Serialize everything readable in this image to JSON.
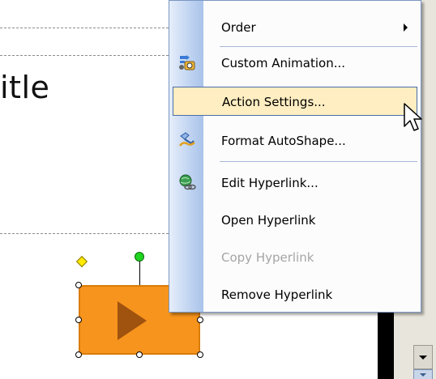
{
  "slide": {
    "title_fragment": "itle"
  },
  "menu": {
    "items": [
      {
        "label": "Order",
        "icon": "",
        "has_submenu": true,
        "enabled": true
      },
      {
        "label": "Custom Animation...",
        "icon": "custom-animation-icon",
        "enabled": true
      },
      {
        "label": "Action Settings...",
        "icon": "",
        "highlighted": true,
        "enabled": true
      },
      {
        "label": "Format AutoShape...",
        "icon": "format-autoshape-icon",
        "enabled": true
      },
      {
        "label": "Edit Hyperlink...",
        "icon": "edit-hyperlink-icon",
        "enabled": true
      },
      {
        "label": "Open Hyperlink",
        "icon": "",
        "enabled": true
      },
      {
        "label": "Copy Hyperlink",
        "icon": "",
        "enabled": false
      },
      {
        "label": "Remove Hyperlink",
        "icon": "",
        "enabled": true
      }
    ]
  },
  "colors": {
    "menu_highlight": "#ffeec2",
    "menu_highlight_border": "#4a6ea9",
    "shape_fill": "#f7941d",
    "disabled_text": "#a5a5a5"
  }
}
